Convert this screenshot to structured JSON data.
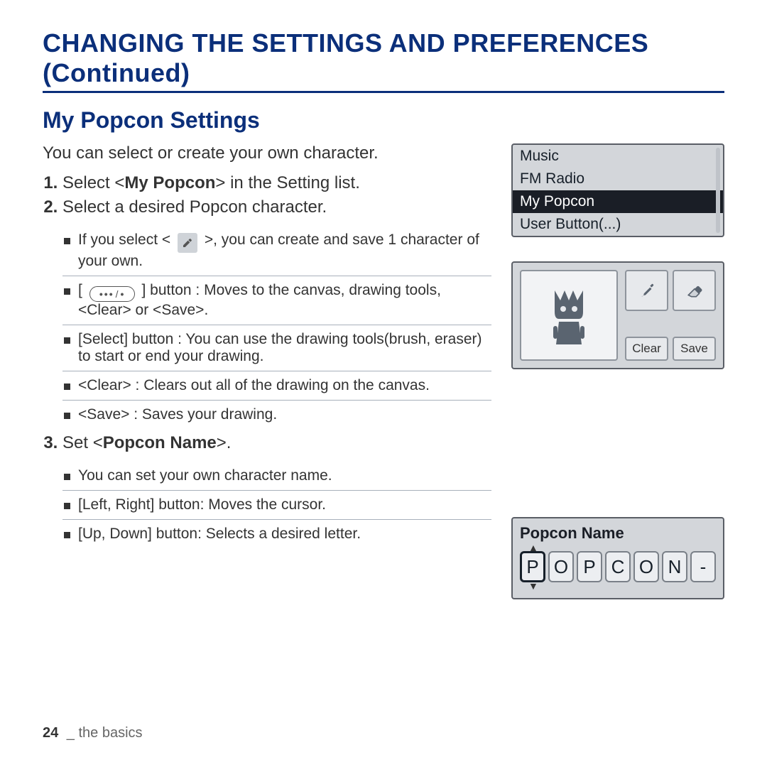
{
  "title": "CHANGING THE SETTINGS AND PREFERENCES (Continued)",
  "subtitle": "My Popcon Settings",
  "intro": "You can select or create your own character.",
  "step1": {
    "pre": "Select <",
    "strong": "My Popcon",
    "post": "> in the Setting list."
  },
  "step2": {
    "text": "Select a desired Popcon character.",
    "b1a": "If you select < ",
    "b1b": " >, you can create and save 1 character of your own.",
    "b2a": "[ ",
    "b2b": " ] button : Moves to the canvas, drawing tools, <Clear> or <Save>.",
    "b3": "[Select] button : You can use the drawing tools(brush, eraser) to start or end your drawing.",
    "b4": "<Clear> : Clears out all of the drawing on the canvas.",
    "b5": "<Save> : Saves your drawing."
  },
  "step3": {
    "pre": "Set <",
    "strong": "Popcon Name",
    "post": ">.",
    "b1": "You can set your own character name.",
    "b2": "[Left, Right] button: Moves the cursor.",
    "b3": "[Up, Down] button: Selects a desired letter."
  },
  "device_list": {
    "r0": "Music",
    "r1": "FM Radio",
    "r2": "My Popcon",
    "r3": "User Button(...)"
  },
  "editor": {
    "clear": "Clear",
    "save": "Save"
  },
  "namebox": {
    "label": "Popcon Name",
    "c0": "P",
    "c1": "O",
    "c2": "P",
    "c3": "C",
    "c4": "O",
    "c5": "N",
    "c6": "-"
  },
  "footer": {
    "page": "24",
    "section": " _ the basics"
  }
}
